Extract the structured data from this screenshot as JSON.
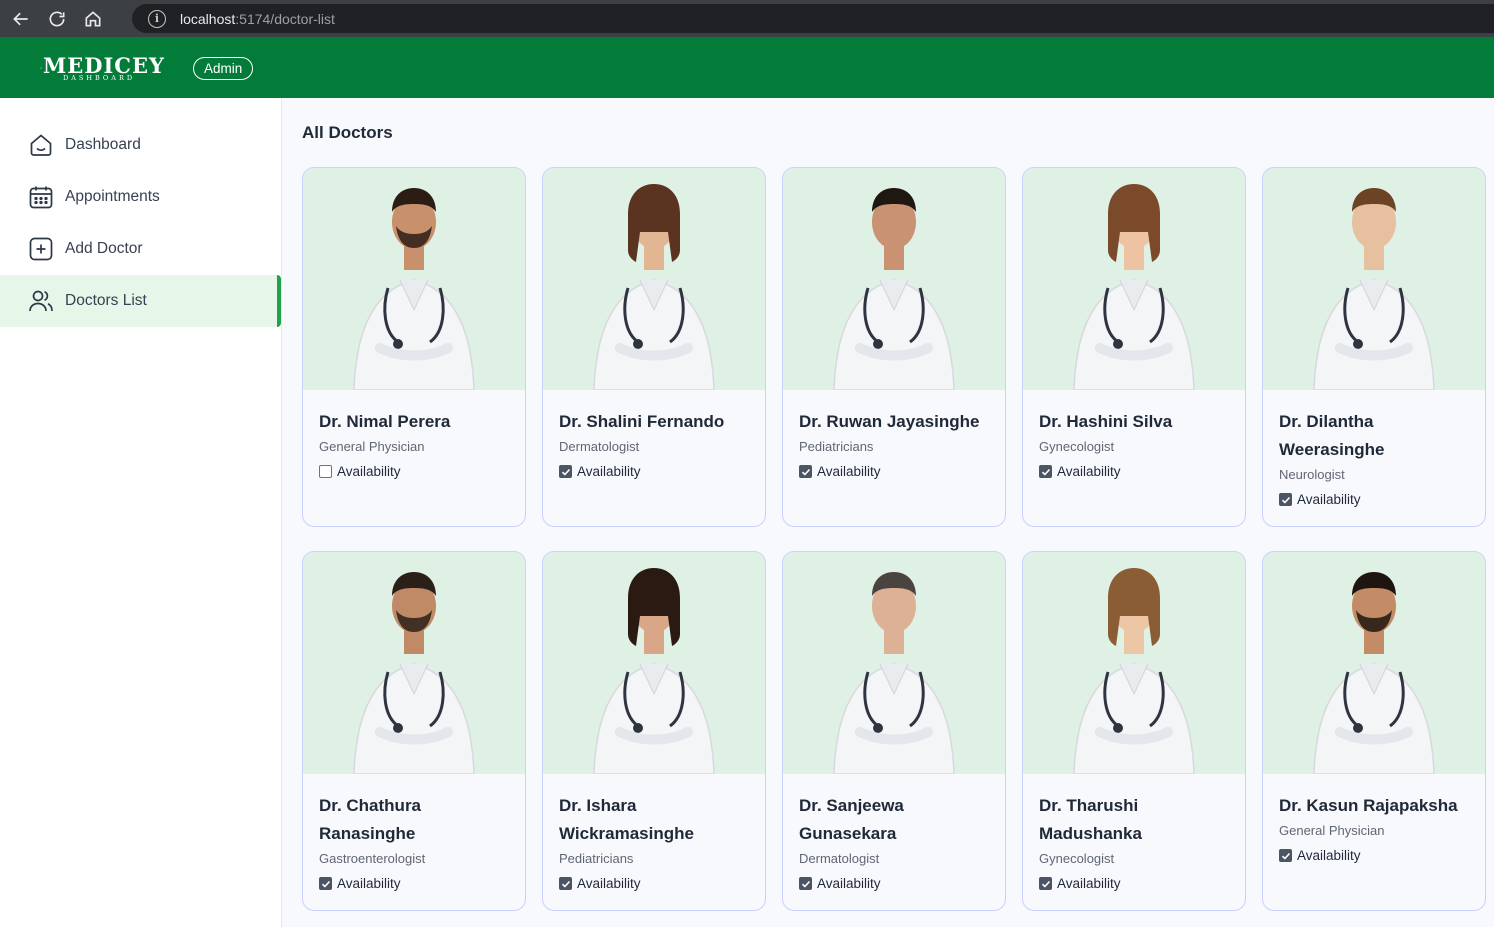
{
  "browser": {
    "url_host": "localhost",
    "url_path": ":5174/doctor-list"
  },
  "header": {
    "logo_name": "MEDICEY",
    "logo_sub": "DASHBOARD",
    "role": "Admin",
    "bg_color": "#027c38"
  },
  "sidebar": {
    "items": [
      {
        "label": "Dashboard",
        "icon": "home-icon",
        "active": false
      },
      {
        "label": "Appointments",
        "icon": "calendar-icon",
        "active": false
      },
      {
        "label": "Add Doctor",
        "icon": "add-square-icon",
        "active": false
      },
      {
        "label": "Doctors List",
        "icon": "people-icon",
        "active": true
      }
    ]
  },
  "main": {
    "title": "All Doctors",
    "availability_label": "Availability",
    "doctors": [
      {
        "name": "Dr. Nimal Perera",
        "speciality": "General Physician",
        "available": false
      },
      {
        "name": "Dr. Shalini Fernando",
        "speciality": "Dermatologist",
        "available": true
      },
      {
        "name": "Dr. Ruwan Jayasinghe",
        "speciality": "Pediatricians",
        "available": true
      },
      {
        "name": "Dr. Hashini Silva",
        "speciality": "Gynecologist",
        "available": true
      },
      {
        "name": "Dr. Dilantha Weerasinghe",
        "speciality": "Neurologist",
        "available": true
      },
      {
        "name": "Dr. Chathura Ranasinghe",
        "speciality": "Gastroenterologist",
        "available": true
      },
      {
        "name": "Dr. Ishara Wickramasinghe",
        "speciality": "Pediatricians",
        "available": true
      },
      {
        "name": "Dr. Sanjeewa Gunasekara",
        "speciality": "Dermatologist",
        "available": true
      },
      {
        "name": "Dr. Tharushi Madushanka",
        "speciality": "Gynecologist",
        "available": true
      },
      {
        "name": "Dr. Kasun Rajapaksha",
        "speciality": "General Physician",
        "available": true
      }
    ]
  }
}
